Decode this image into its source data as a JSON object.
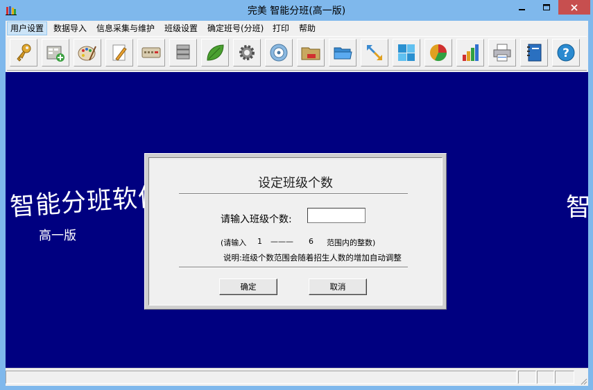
{
  "window": {
    "title": "完美 智能分班(高一版)",
    "buttons": [
      "minimize-icon",
      "maximize-icon",
      "close-icon"
    ]
  },
  "menubar": {
    "items": [
      {
        "label": "用户设置",
        "active": true
      },
      {
        "label": "数据导入"
      },
      {
        "label": "信息采集与维护"
      },
      {
        "label": "班级设置"
      },
      {
        "label": "确定班号(分班)"
      },
      {
        "label": "打印"
      },
      {
        "label": "帮助"
      }
    ]
  },
  "toolbar": {
    "icons": [
      "key-icon",
      "add-record-icon",
      "palette-icon",
      "edit-icon",
      "keyboard-icon",
      "database-icon",
      "leaf-icon",
      "gear-icon",
      "disc-icon",
      "folder-icon",
      "open-folder-icon",
      "arrows-icon",
      "tiles-icon",
      "pie-chart-icon",
      "bar-chart-icon",
      "printer-icon",
      "notebook-icon",
      "help-icon"
    ]
  },
  "brand": {
    "left_title": "智能分班软件",
    "left_subtitle": "高一版",
    "right_title": "智"
  },
  "dialog": {
    "title": "设定班级个数",
    "prompt": "请输入班级个数:",
    "input_value": "",
    "range_prefix": "(请输入",
    "range_min": "1",
    "range_dash": "———",
    "range_max": "6",
    "range_suffix": "范围内的整数)",
    "note": "说明:班级个数范围会随着招生人数的增加自动调整",
    "ok_label": "确定",
    "cancel_label": "取消"
  },
  "colors": {
    "title_bar": "#7fb8ec",
    "workspace": "#000080",
    "close_button": "#c74f4f"
  }
}
